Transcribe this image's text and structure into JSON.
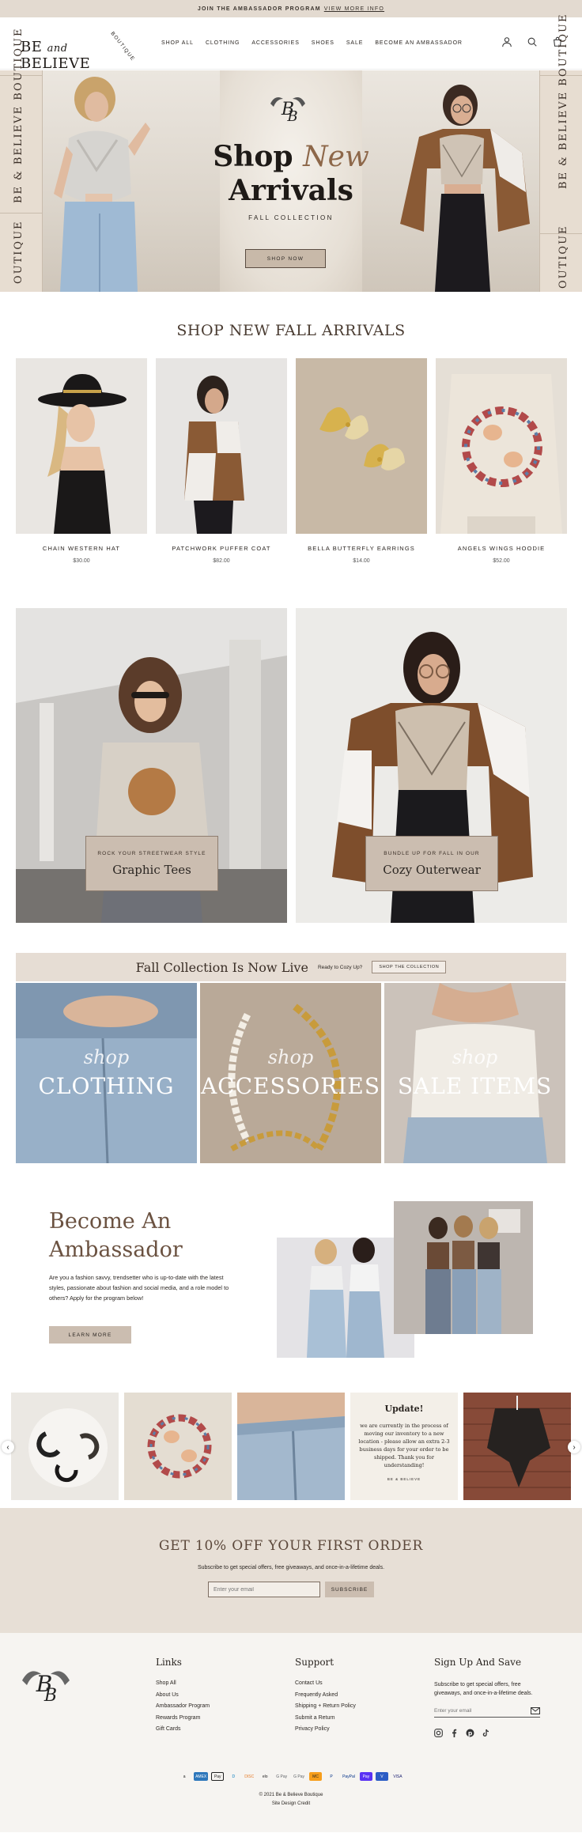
{
  "announcement": {
    "text": "JOIN THE AMBASSADOR PROGRAM",
    "link": "VIEW MORE INFO"
  },
  "header": {
    "logo_main": "BE",
    "logo_and": "and",
    "logo_rest": "BELIEVE",
    "logo_arc": "BOUTIQUE",
    "nav": [
      "SHOP ALL",
      "CLOTHING",
      "ACCESSORIES",
      "SHOES",
      "SALE",
      "BECOME AN AMBASSADOR"
    ]
  },
  "hero": {
    "strip_text": "BE & BELIEVE BOUTIQUE",
    "strip_text_short": "OUTIQUE",
    "title_a": "Shop",
    "title_b": "New",
    "title_c": "Arrivals",
    "subtitle": "FALL COLLECTION",
    "button": "SHOP NOW"
  },
  "new_arrivals": {
    "title": "SHOP NEW FALL ARRIVALS",
    "products": [
      {
        "name": "CHAIN WESTERN HAT",
        "price": "$30.00"
      },
      {
        "name": "PATCHWORK PUFFER COAT",
        "price": "$82.00"
      },
      {
        "name": "BELLA BUTTERFLY EARRINGS",
        "price": "$14.00"
      },
      {
        "name": "ANGELS WINGS HOODIE",
        "price": "$52.00"
      }
    ]
  },
  "features": [
    {
      "kicker": "ROCK YOUR STREETWEAR STYLE",
      "title": "Graphic Tees"
    },
    {
      "kicker": "BUNDLE UP FOR FALL IN OUR",
      "title": "Cozy Outerwear"
    }
  ],
  "fall": {
    "title": "Fall Collection Is Now Live",
    "question": "Ready to Cozy Up?",
    "button": "SHOP THE COLLECTION",
    "categories": [
      {
        "script": "shop",
        "label": "CLOTHING"
      },
      {
        "script": "shop",
        "label": "ACCESSORIES"
      },
      {
        "script": "shop",
        "label": "SALE ITEMS"
      }
    ]
  },
  "ambassador": {
    "title_1": "Become An",
    "title_2": "Ambassador",
    "body": "Are you a fashion savvy, trendsetter who is up-to-date with the latest styles, passionate about fashion and social media, and a role model to others? Apply for the program below!",
    "button": "LEARN MORE"
  },
  "instagram": {
    "update_title": "Update!",
    "update_body": "we are currently in the process of moving our inventory to a new location - please allow an extra 2-3 business days for your order to be shipped. Thank you for understanding!",
    "update_sign": "BE & BELIEVE"
  },
  "newsletter": {
    "title": "GET 10% OFF YOUR FIRST ORDER",
    "subtitle": "Subscribe to get special offers, free giveaways, and once-in-a-lifetime deals.",
    "placeholder": "Enter your email",
    "button": "SUBSCRIBE"
  },
  "footer": {
    "links_title": "Links",
    "links": [
      "Shop All",
      "About Us",
      "Ambassador Program",
      "Rewards Program",
      "Gift Cards"
    ],
    "support_title": "Support",
    "support": [
      "Contact Us",
      "Frequently Asked",
      "Shipping + Return Policy",
      "Submit a Return",
      "Privacy Policy"
    ],
    "signup_title": "Sign Up And Save",
    "signup_text": "Subscribe to get special offers, free giveaways, and once-in-a-lifetime deals.",
    "signup_placeholder": "Enter your email",
    "payments": [
      "a",
      "AMEX",
      "Pay",
      "D",
      "DISC",
      "elo",
      "G Pay",
      "G Pay",
      "MC",
      "P",
      "PayPal",
      "Pay",
      "V",
      "VISA"
    ],
    "copyright": "© 2021 Be & Believe Boutique",
    "credit": "Site Design Credit"
  }
}
